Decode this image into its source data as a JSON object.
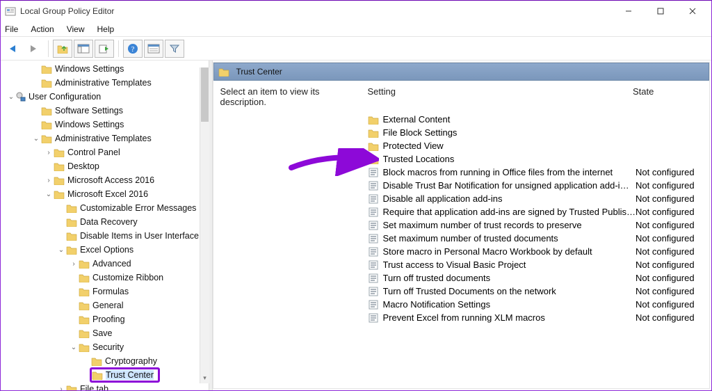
{
  "window": {
    "title": "Local Group Policy Editor"
  },
  "menu": [
    "File",
    "Action",
    "View",
    "Help"
  ],
  "tree": [
    {
      "depth": 2,
      "icon": "folder",
      "label": "Windows Settings"
    },
    {
      "depth": 2,
      "icon": "folder",
      "label": "Administrative Templates"
    },
    {
      "depth": 0,
      "expand": "open",
      "icon": "gear",
      "label": "User Configuration"
    },
    {
      "depth": 2,
      "icon": "folder",
      "label": "Software Settings"
    },
    {
      "depth": 2,
      "icon": "folder",
      "label": "Windows Settings"
    },
    {
      "depth": 2,
      "expand": "open",
      "icon": "folder",
      "label": "Administrative Templates"
    },
    {
      "depth": 3,
      "expand": "closed",
      "icon": "folder",
      "label": "Control Panel"
    },
    {
      "depth": 3,
      "icon": "folder",
      "label": "Desktop"
    },
    {
      "depth": 3,
      "expand": "closed",
      "icon": "folder",
      "label": "Microsoft Access 2016"
    },
    {
      "depth": 3,
      "expand": "open",
      "icon": "folder",
      "label": "Microsoft Excel 2016"
    },
    {
      "depth": 4,
      "icon": "folder",
      "label": "Customizable Error Messages"
    },
    {
      "depth": 4,
      "icon": "folder",
      "label": "Data Recovery"
    },
    {
      "depth": 4,
      "icon": "folder",
      "label": "Disable Items in User Interface"
    },
    {
      "depth": 4,
      "expand": "open",
      "icon": "folder",
      "label": "Excel Options"
    },
    {
      "depth": 5,
      "expand": "closed",
      "icon": "folder",
      "label": "Advanced"
    },
    {
      "depth": 5,
      "icon": "folder",
      "label": "Customize Ribbon"
    },
    {
      "depth": 5,
      "icon": "folder",
      "label": "Formulas"
    },
    {
      "depth": 5,
      "icon": "folder",
      "label": "General"
    },
    {
      "depth": 5,
      "icon": "folder",
      "label": "Proofing"
    },
    {
      "depth": 5,
      "icon": "folder",
      "label": "Save"
    },
    {
      "depth": 5,
      "expand": "open",
      "icon": "folder",
      "label": "Security"
    },
    {
      "depth": 6,
      "icon": "folder",
      "label": "Cryptography"
    },
    {
      "depth": 6,
      "icon": "folder",
      "label": "Trust Center",
      "selected": true
    },
    {
      "depth": 4,
      "expand": "closed",
      "icon": "folder",
      "label": "File tab"
    }
  ],
  "pane": {
    "title": "Trust Center",
    "description": "Select an item to view its description.",
    "headers": {
      "setting": "Setting",
      "state": "State"
    },
    "folders": [
      "External Content",
      "File Block Settings",
      "Protected View",
      "Trusted Locations"
    ],
    "policies": [
      {
        "name": "Block macros from running in Office files from the internet",
        "state": "Not configured"
      },
      {
        "name": "Disable Trust Bar Notification for unsigned application add-i…",
        "state": "Not configured"
      },
      {
        "name": "Disable all application add-ins",
        "state": "Not configured"
      },
      {
        "name": "Require that application add-ins are signed by Trusted Publis…",
        "state": "Not configured"
      },
      {
        "name": "Set maximum number of trust records to preserve",
        "state": "Not configured"
      },
      {
        "name": "Set maximum number of trusted documents",
        "state": "Not configured"
      },
      {
        "name": "Store macro in Personal Macro Workbook by default",
        "state": "Not configured"
      },
      {
        "name": "Trust access to Visual Basic Project",
        "state": "Not configured"
      },
      {
        "name": "Turn off trusted documents",
        "state": "Not configured"
      },
      {
        "name": "Turn off Trusted Documents on the network",
        "state": "Not configured"
      },
      {
        "name": "Macro Notification Settings",
        "state": "Not configured"
      },
      {
        "name": "Prevent Excel from running XLM macros",
        "state": "Not configured"
      }
    ]
  }
}
